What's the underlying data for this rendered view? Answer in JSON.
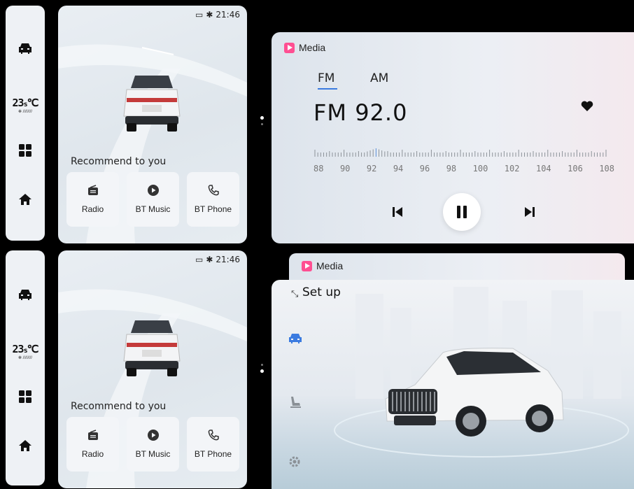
{
  "status": {
    "time": "21:46"
  },
  "rail": {
    "temp_value": "23",
    "temp_unit": "℃",
    "temp_sub": "s"
  },
  "home": {
    "recommend_title": "Recommend to you",
    "shortcuts": [
      {
        "label": "Radio",
        "icon": "radio-icon"
      },
      {
        "label": "BT Music",
        "icon": "play-circle-icon"
      },
      {
        "label": "BT Phone",
        "icon": "phone-icon"
      }
    ]
  },
  "media": {
    "title": "Media",
    "bands": [
      "FM",
      "AM"
    ],
    "active_band": "FM",
    "frequency": "FM 92.0",
    "scale_labels": [
      "88",
      "90",
      "92",
      "94",
      "96",
      "98",
      "100",
      "102",
      "104",
      "106",
      "108"
    ],
    "favorite": true
  },
  "setup": {
    "title": "Set up"
  },
  "colors": {
    "accent": "#3b7be0",
    "media_icon": "#ff4f92",
    "setup_icon_active": "#3b7be0"
  }
}
